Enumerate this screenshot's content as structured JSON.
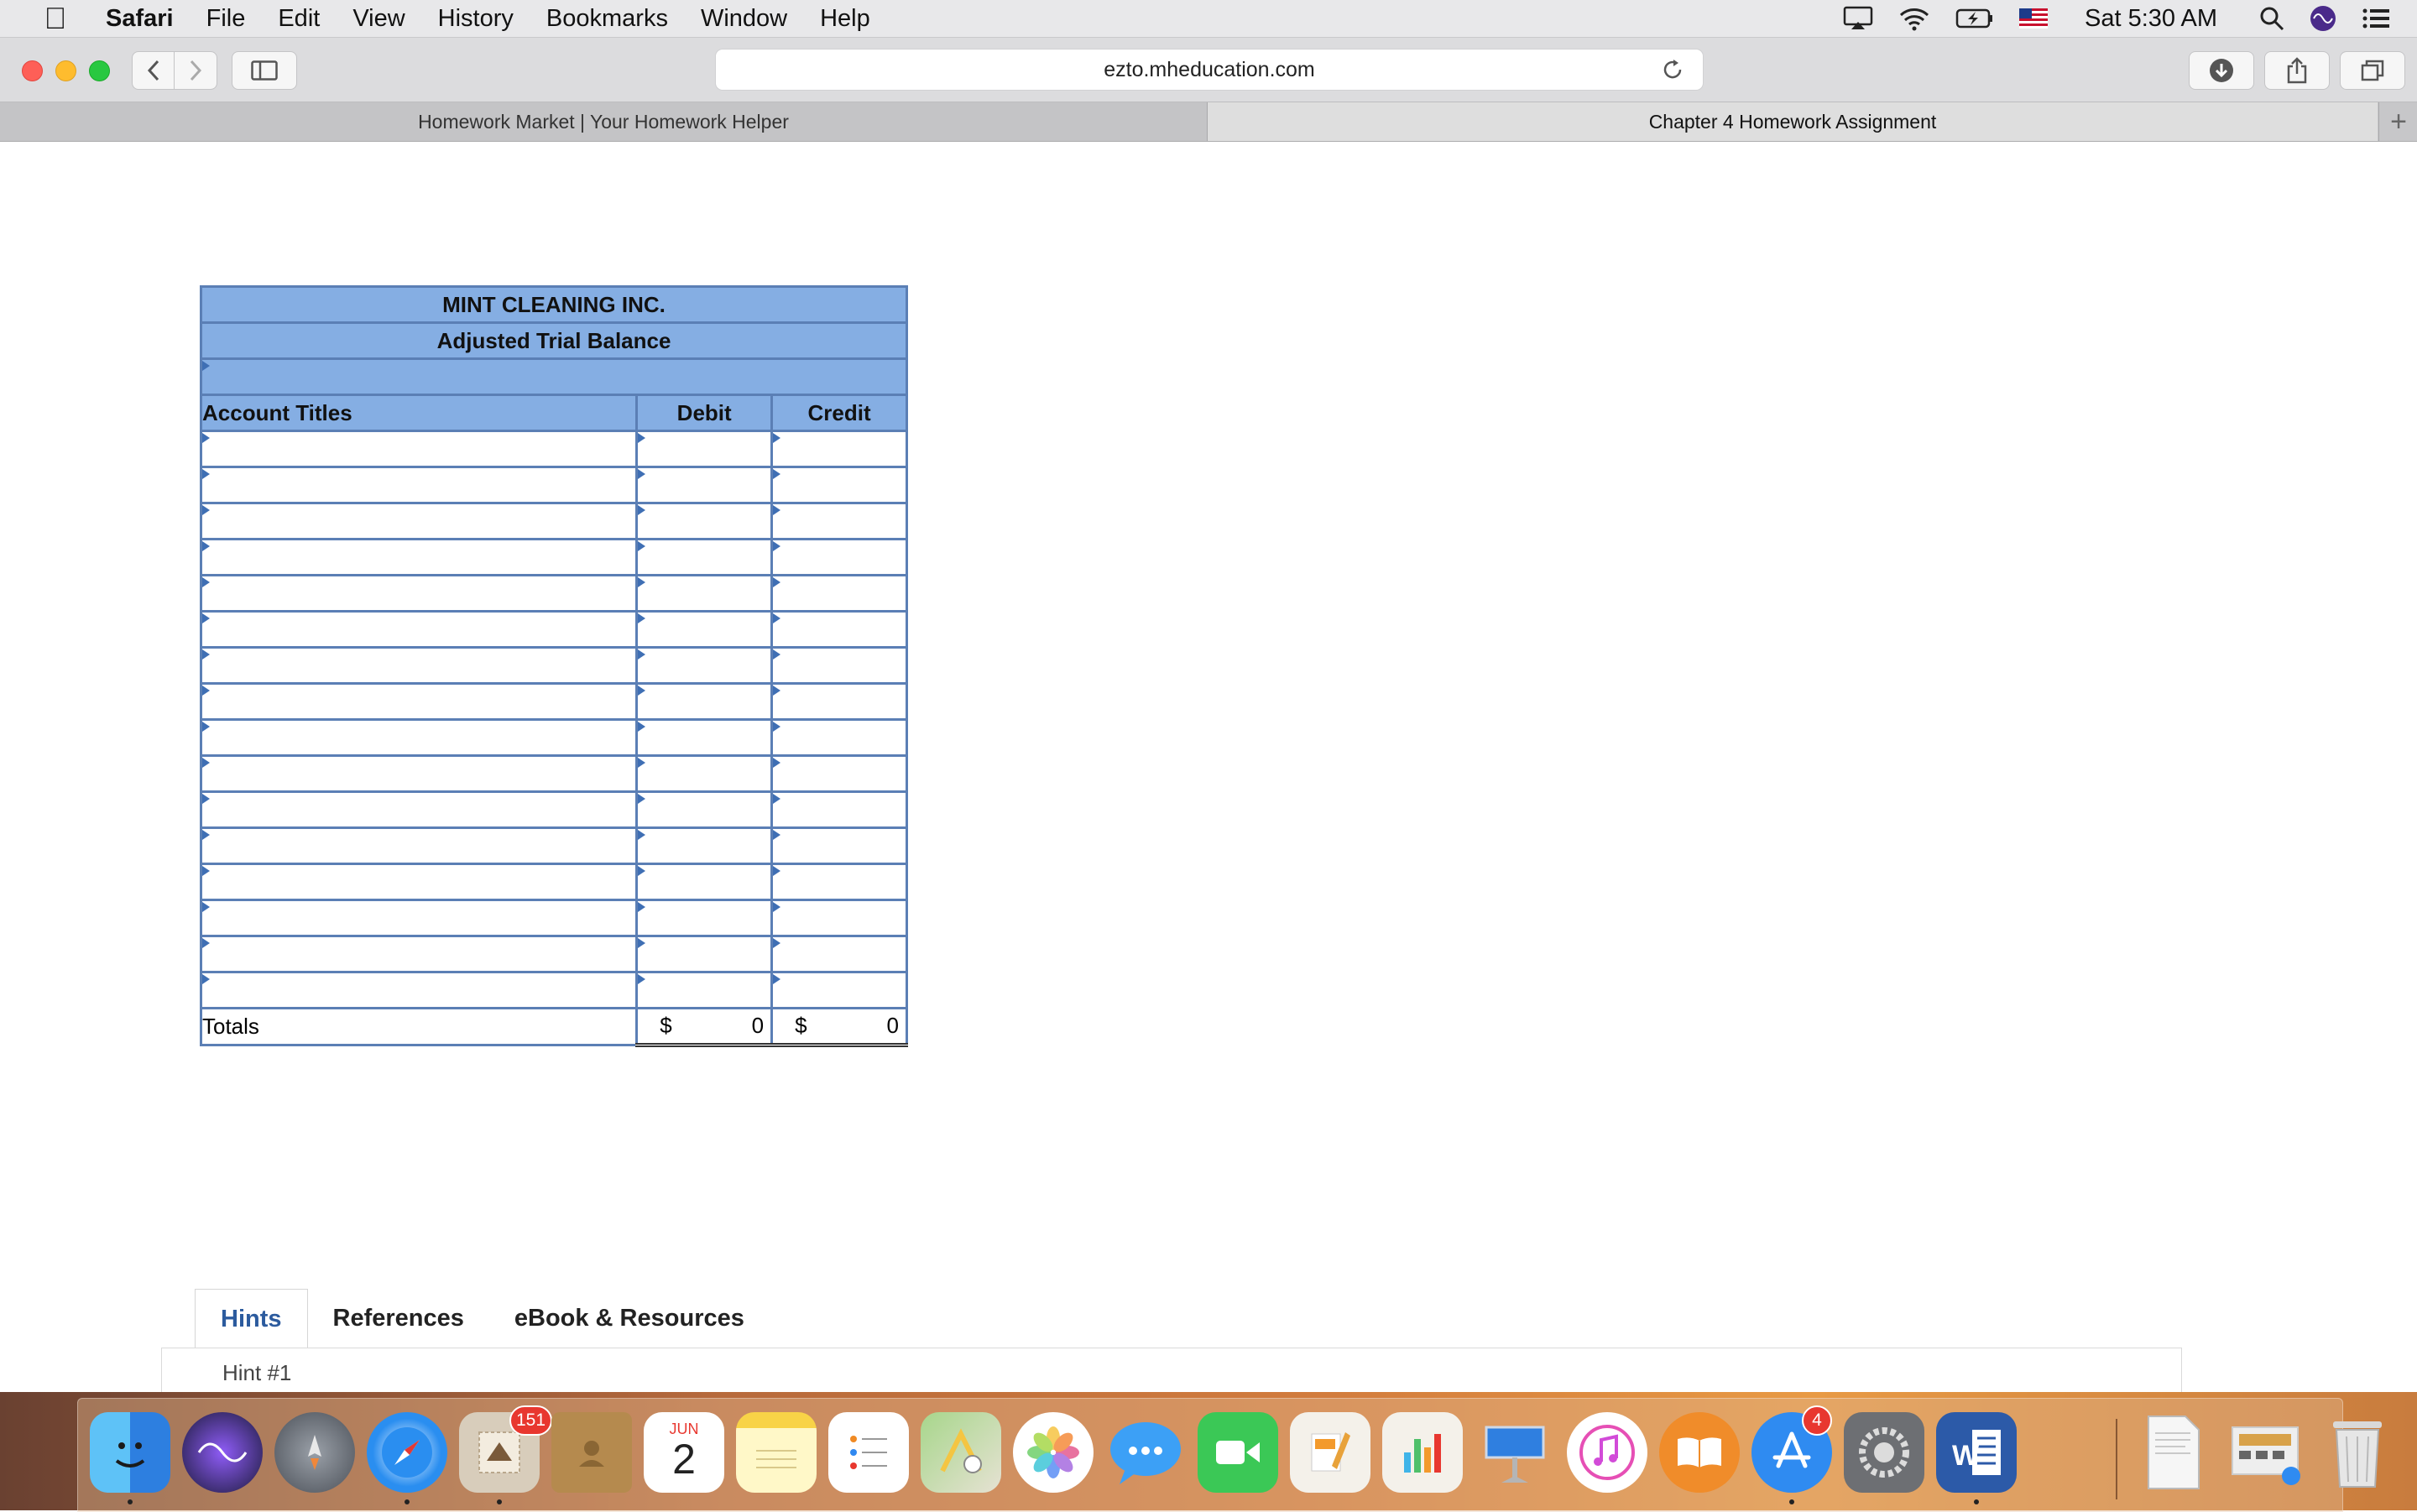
{
  "menubar": {
    "app": "Safari",
    "items": [
      "File",
      "Edit",
      "View",
      "History",
      "Bookmarks",
      "Window",
      "Help"
    ],
    "clock": "Sat 5:30 AM"
  },
  "toolbar": {
    "url": "ezto.mheducation.com"
  },
  "tabs": [
    {
      "label": "Homework Market | Your Homework Helper",
      "active": false
    },
    {
      "label": "Chapter 4 Homework Assignment",
      "active": true
    }
  ],
  "worksheet": {
    "company": "MINT CLEANING INC.",
    "statement": "Adjusted Trial Balance",
    "date_line": "",
    "columns": {
      "account": "Account Titles",
      "debit": "Debit",
      "credit": "Credit"
    },
    "totals": {
      "label": "Totals",
      "debit_currency": "$",
      "debit": "0",
      "credit_currency": "$",
      "credit": "0"
    },
    "accent_color": "#85aee3"
  },
  "resources": {
    "tabs": [
      "Hints",
      "References",
      "eBook & Resources"
    ],
    "active_tab": "Hints",
    "hint_label": "Hint #1"
  },
  "dock": {
    "apps": [
      "Finder",
      "Siri",
      "Launchpad",
      "Safari",
      "Mail",
      "Contacts",
      "Calendar",
      "Notes",
      "Reminders",
      "Maps",
      "Photos",
      "Messages",
      "FaceTime",
      "Pages",
      "Numbers",
      "Keynote",
      "iTunes",
      "iBooks",
      "App Store",
      "System Preferences",
      "Microsoft Word",
      "Document",
      "Downloads",
      "Trash"
    ],
    "mail_badge": "151",
    "appstore_badge": "4",
    "calendar_month": "JUN",
    "calendar_day": "2"
  }
}
